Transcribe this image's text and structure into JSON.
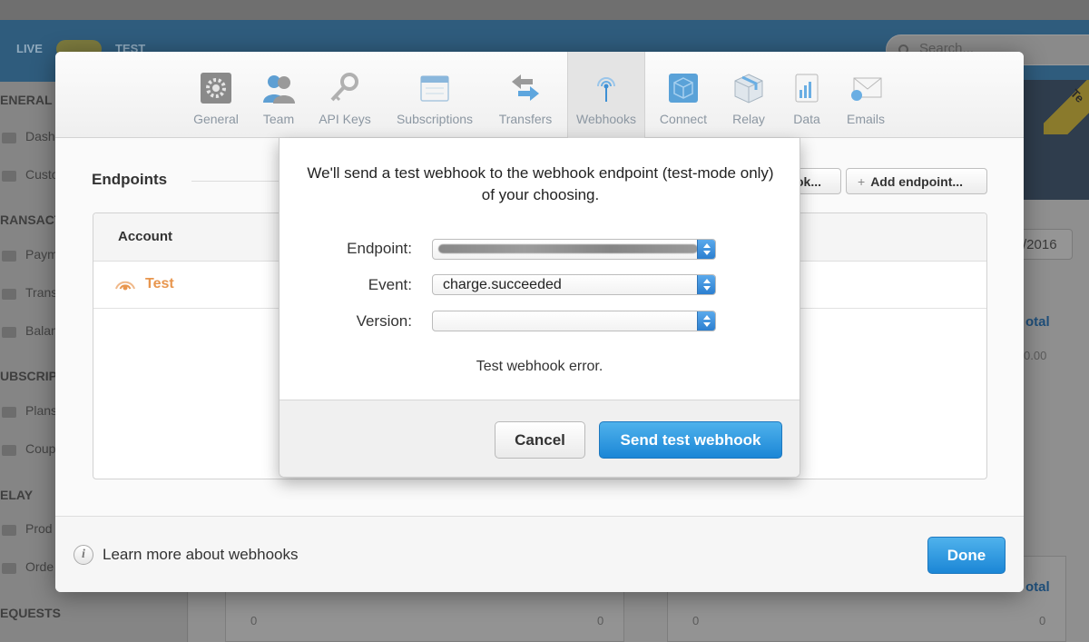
{
  "background": {
    "mode_live": "LIVE",
    "mode_test": "TEST",
    "search_placeholder": "Search...",
    "sidebar": {
      "sections": [
        "ENERAL",
        "RANSACT",
        "UBSCRIPTI",
        "ELAY",
        "EQUESTS"
      ],
      "items": [
        "Dash",
        "Custo",
        "Paym",
        "Trans",
        "Balan",
        "Plans",
        "Coup",
        "Prod",
        "Orde"
      ]
    },
    "ribbon_text": "Te",
    "date_fragment": "/2016",
    "total_label_1": "otal",
    "total_value_1": "0.00",
    "total_label_2": "otal",
    "axis_zero": "0"
  },
  "settings": {
    "tabs": [
      {
        "label": "General",
        "icon": "gear-icon",
        "active": false
      },
      {
        "label": "Team",
        "icon": "team-icon",
        "active": false
      },
      {
        "label": "API Keys",
        "icon": "key-icon",
        "active": false
      },
      {
        "label": "Subscriptions",
        "icon": "calendar-icon",
        "active": false
      },
      {
        "label": "Transfers",
        "icon": "transfer-arrows-icon",
        "active": false
      },
      {
        "label": "Webhooks",
        "icon": "broadcast-icon",
        "active": true
      },
      {
        "label": "Connect",
        "icon": "cube-icon",
        "active": false
      },
      {
        "label": "Relay",
        "icon": "box-icon",
        "active": false
      },
      {
        "label": "Data",
        "icon": "chart-icon",
        "active": false
      },
      {
        "label": "Emails",
        "icon": "envelope-icon",
        "active": false
      }
    ],
    "endpoints_title": "Endpoints",
    "test_button_label": "ok...",
    "add_button_label": "Add endpoint...",
    "table": {
      "column_account": "Account",
      "rows": [
        {
          "name": "Test",
          "icon": "broadcast-icon"
        }
      ]
    },
    "footer": {
      "learn_more": "Learn more about webhooks",
      "done_label": "Done"
    }
  },
  "sheet": {
    "message": "We'll send a test webhook to the webhook endpoint (test-mode only) of your choosing.",
    "endpoint_label": "Endpoint:",
    "event_label": "Event:",
    "event_value": "charge.succeeded",
    "version_label": "Version:",
    "version_value": "",
    "error_text": "Test webhook error.",
    "cancel_label": "Cancel",
    "send_label": "Send test webhook"
  },
  "colors": {
    "accent_blue": "#1b86d6",
    "webhook_orange": "#e8964e",
    "header_blue": "#2f5c7d"
  }
}
